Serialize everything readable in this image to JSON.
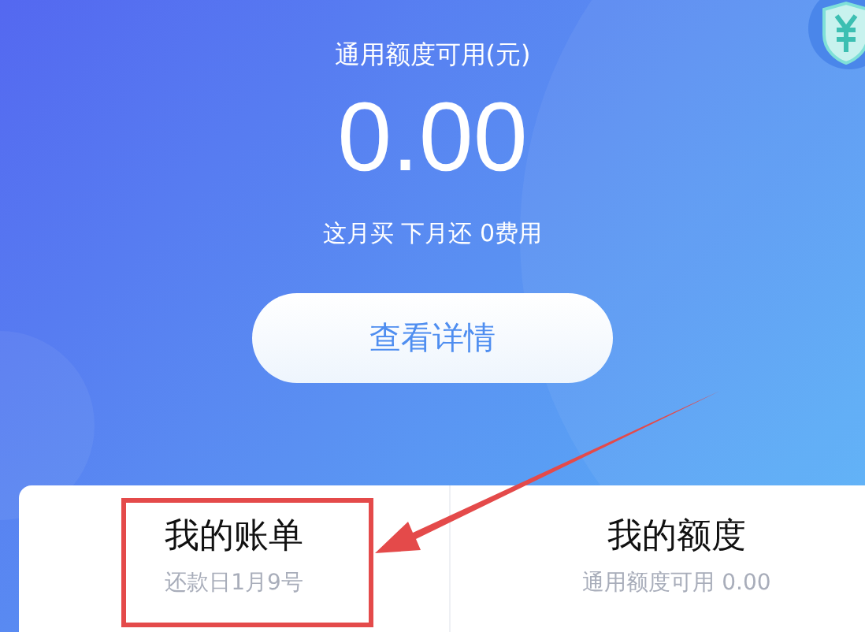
{
  "header": {
    "label": "通用额度可用(元)",
    "amount": "0.00",
    "tagline": "这月买 下月还 0费用",
    "button": "查看详情"
  },
  "tiles": [
    {
      "title": "我的账单",
      "subtitle": "还款日1月9号",
      "highlighted": true
    },
    {
      "title": "我的额度",
      "subtitle": "通用额度可用 0.00",
      "highlighted": false
    }
  ]
}
